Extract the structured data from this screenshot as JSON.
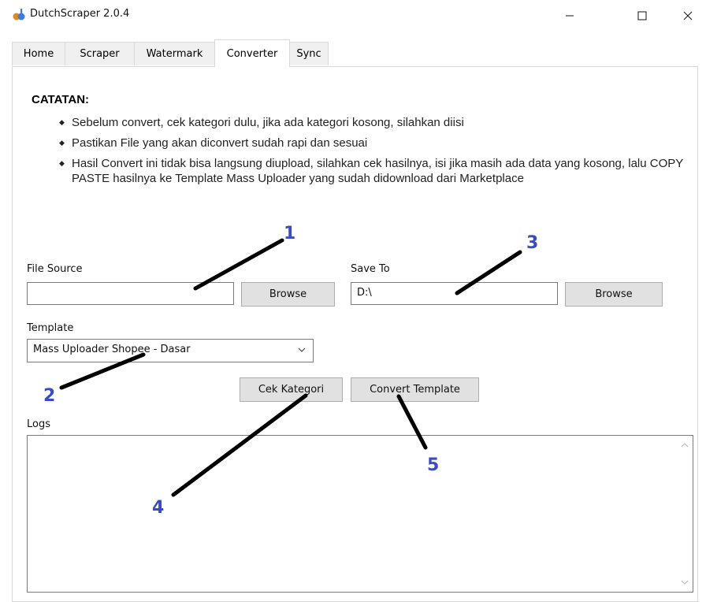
{
  "window": {
    "title": "DutchScraper 2.0.4",
    "minimize": "—",
    "maximize": "☐",
    "close": "✕"
  },
  "tabs": [
    {
      "label": "Home"
    },
    {
      "label": "Scraper"
    },
    {
      "label": "Watermark"
    },
    {
      "label": "Converter",
      "active": true
    },
    {
      "label": "Sync"
    }
  ],
  "notes": {
    "title": "CATATAN:",
    "items": [
      "Sebelum convert, cek kategori dulu, jika ada kategori kosong, silahkan diisi",
      "Pastikan File yang akan diconvert sudah rapi dan sesuai",
      "Hasil Convert ini tidak bisa langsung diupload, silahkan cek hasilnya, isi jika masih ada data yang kosong, lalu COPY PASTE hasilnya ke Template Mass Uploader yang sudah didownload dari Marketplace"
    ]
  },
  "file_source": {
    "label": "File Source",
    "value": "",
    "browse_label": "Browse"
  },
  "save_to": {
    "label": "Save To",
    "value": "D:\\",
    "browse_label": "Browse"
  },
  "template": {
    "label": "Template",
    "selected": "Mass Uploader Shopee - Dasar"
  },
  "actions": {
    "cek_kategori": "Cek Kategori",
    "convert_template": "Convert Template"
  },
  "logs": {
    "label": "Logs",
    "content": ""
  },
  "callouts": [
    "1",
    "2",
    "3",
    "4",
    "5"
  ],
  "colors": {
    "callout": "#3b4cc0",
    "accent": "#0078d7"
  }
}
